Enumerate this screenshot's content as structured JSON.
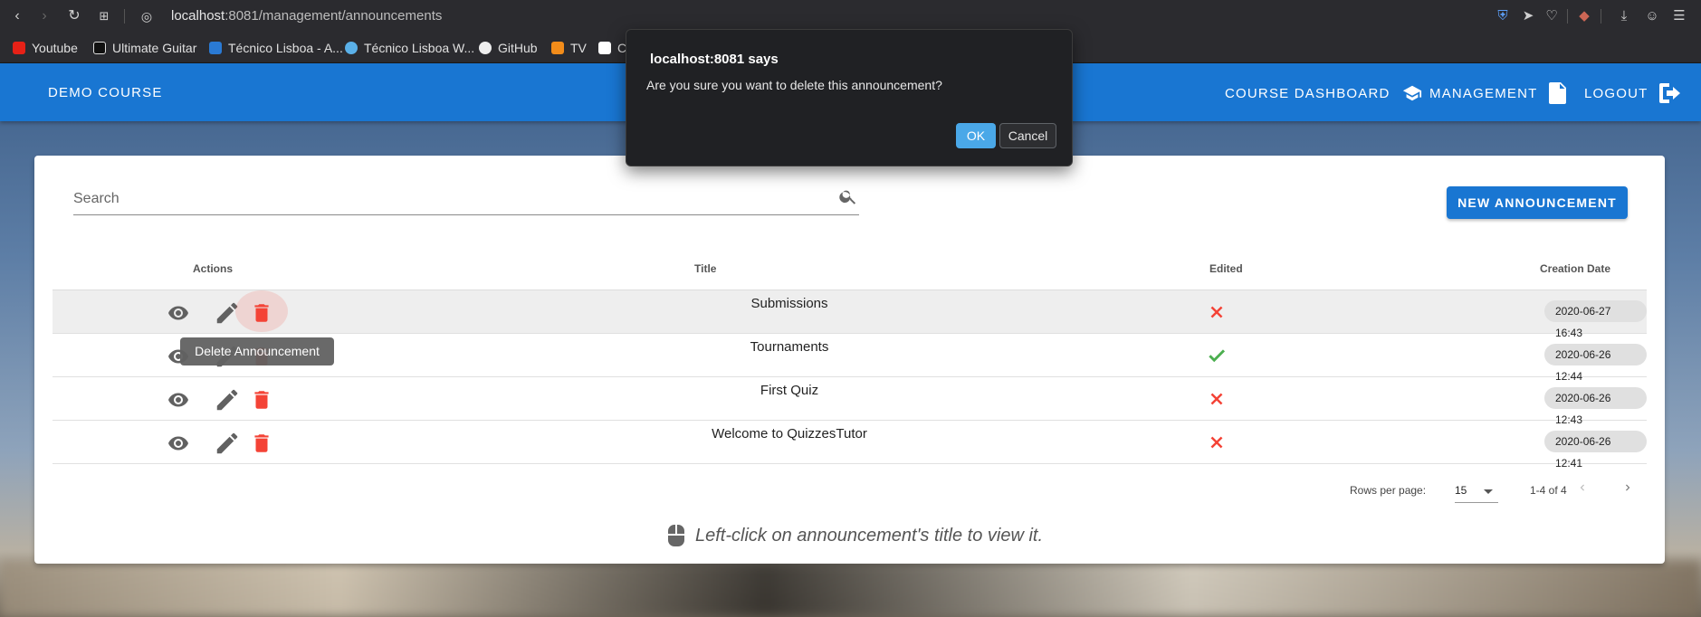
{
  "browser": {
    "url_host": "localhost",
    "url_path": ":8081/management/announcements",
    "bookmarks": [
      "Youtube",
      "Ultimate Guitar",
      "Técnico Lisboa - A...",
      "Técnico Lisboa W...",
      "GitHub",
      "TV",
      "C"
    ]
  },
  "header": {
    "course_name": "DEMO COURSE",
    "nav": {
      "dashboard": "COURSE DASHBOARD",
      "management": "MANAGEMENT",
      "logout": "LOGOUT"
    }
  },
  "search": {
    "placeholder": "Search"
  },
  "new_button": "NEW ANNOUNCEMENT",
  "table": {
    "headers": {
      "actions": "Actions",
      "title": "Title",
      "edited": "Edited",
      "date": "Creation Date"
    },
    "rows": [
      {
        "title": "Submissions",
        "edited": false,
        "date": "2020-06-27 16:43"
      },
      {
        "title": "Tournaments",
        "edited": true,
        "date": "2020-06-26 12:44"
      },
      {
        "title": "First Quiz",
        "edited": false,
        "date": "2020-06-26 12:43"
      },
      {
        "title": "Welcome to QuizzesTutor",
        "edited": false,
        "date": "2020-06-26 12:41"
      }
    ]
  },
  "tooltip": "Delete Announcement",
  "footer": {
    "rows_per_page_label": "Rows per page:",
    "rows_per_page_value": "15",
    "page_info": "1-4 of 4",
    "hint": "Left-click on announcement's title to view it."
  },
  "dialog": {
    "title": "localhost:8081 says",
    "message": "Are you sure you want to delete this announcement?",
    "ok": "OK",
    "cancel": "Cancel"
  },
  "colors": {
    "primary": "#1976d2",
    "delete": "#f44336",
    "edited_true": "#4caf50",
    "edited_false": "#f44336"
  }
}
